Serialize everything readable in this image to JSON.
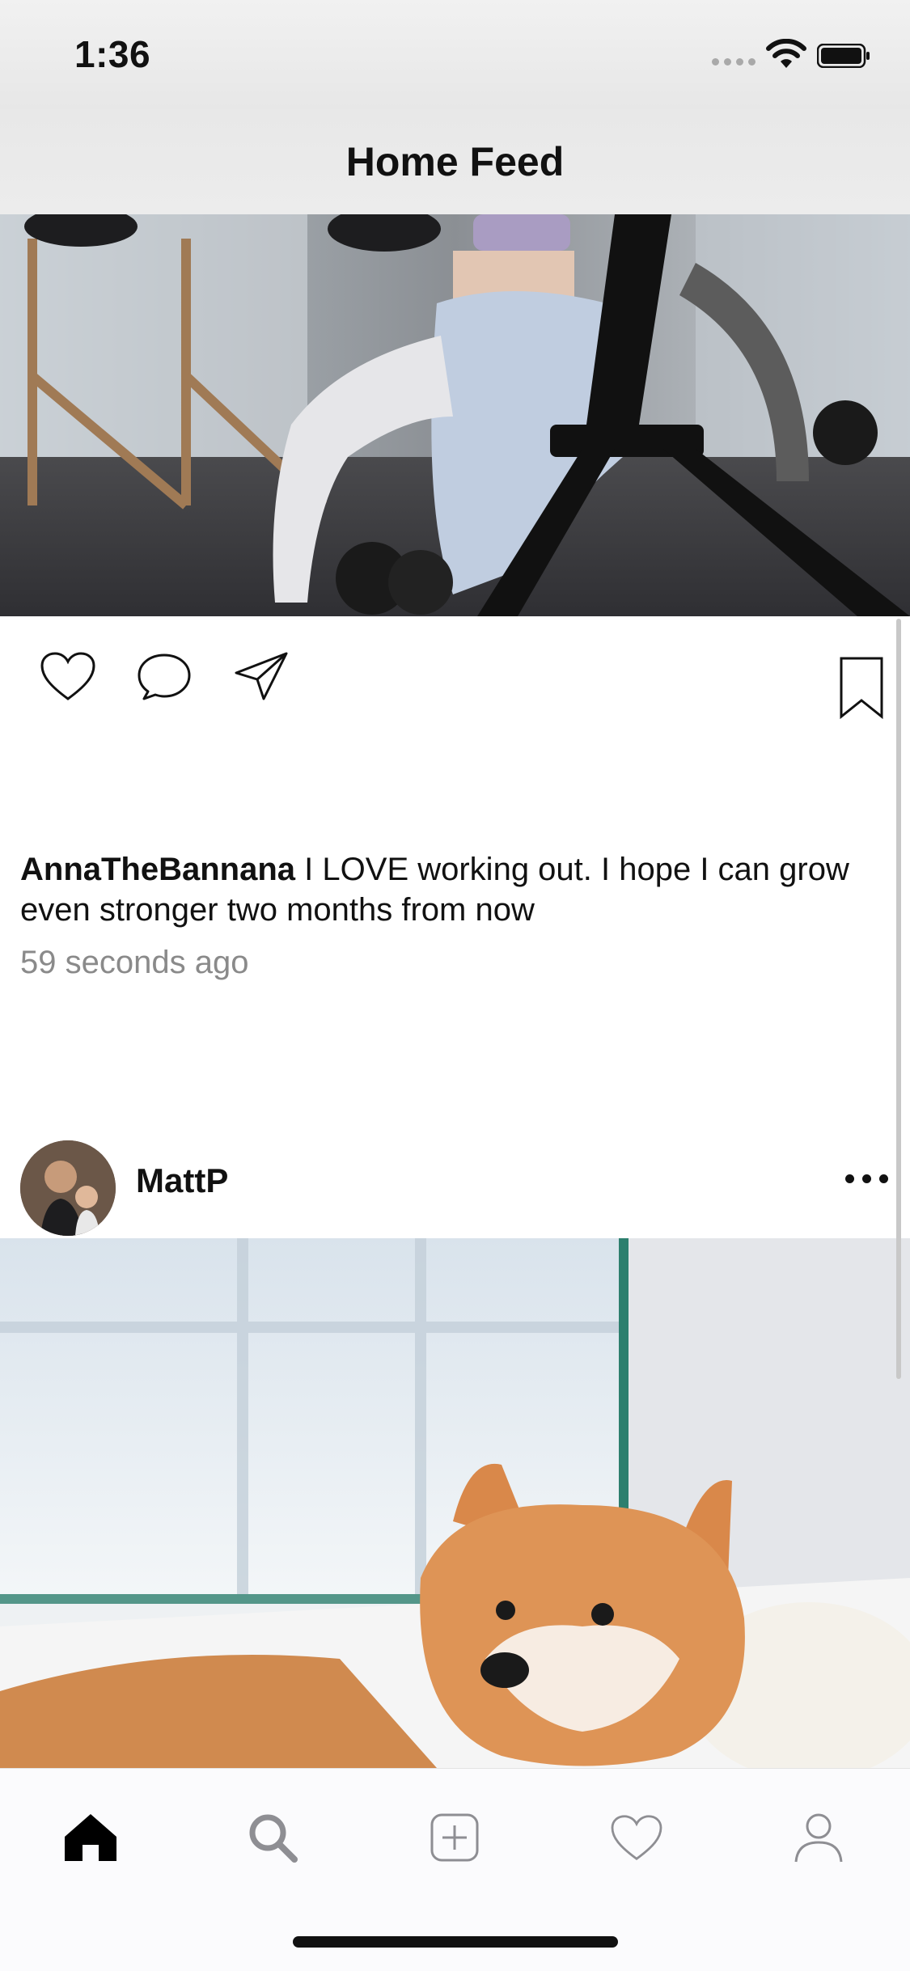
{
  "status_bar": {
    "time": "1:36"
  },
  "nav": {
    "title": "Home Feed"
  },
  "post1": {
    "username": "AnnaTheBannana",
    "caption": "I LOVE working out. I hope I can grow even stronger two months from now",
    "time_ago": "59 seconds ago",
    "actions": [
      "heart-icon",
      "comment-icon",
      "share-icon",
      "bookmark-icon"
    ]
  },
  "post2": {
    "username": "MattP",
    "more_icon": "more-dots-icon"
  },
  "tabbar": {
    "items": [
      "home-icon",
      "search-icon",
      "add-post-icon",
      "activity-heart-icon",
      "profile-icon"
    ],
    "active": "home-icon"
  },
  "colors": {
    "text": "#111111",
    "muted": "#8a8a8a",
    "tab_inactive": "#8e8e93",
    "tab_active": "#000000"
  }
}
